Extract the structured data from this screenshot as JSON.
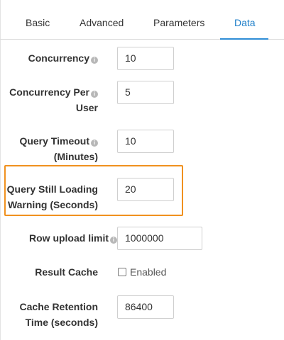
{
  "tabs": [
    {
      "label": "Basic",
      "active": false
    },
    {
      "label": "Advanced",
      "active": false
    },
    {
      "label": "Parameters",
      "active": false
    },
    {
      "label": "Data",
      "active": true
    }
  ],
  "fields": {
    "concurrency": {
      "label": "Concurrency",
      "value": "10",
      "info_icon": "info-icon"
    },
    "concurrency_per_user": {
      "label_line1": "Concurrency Per",
      "label_line2": "User",
      "value": "5",
      "info_icon": "info-icon"
    },
    "query_timeout": {
      "label_line1": "Query Timeout",
      "label_line2": "(Minutes)",
      "value": "10",
      "info_icon": "info-icon"
    },
    "query_still_loading": {
      "label_line1": "Query Still Loading",
      "label_line2": "Warning (Seconds)",
      "value": "20"
    },
    "row_upload_limit": {
      "label": "Row upload limit",
      "value": "1000000",
      "info_icon": "info-icon"
    },
    "result_cache": {
      "label": "Result Cache",
      "checkbox_label": "Enabled",
      "checked": false
    },
    "cache_retention": {
      "label_line1": "Cache Retention",
      "label_line2": "Time (seconds)",
      "value": "86400"
    }
  },
  "colors": {
    "active_tab": "#1f7fc9",
    "highlight": "#f0911f"
  }
}
